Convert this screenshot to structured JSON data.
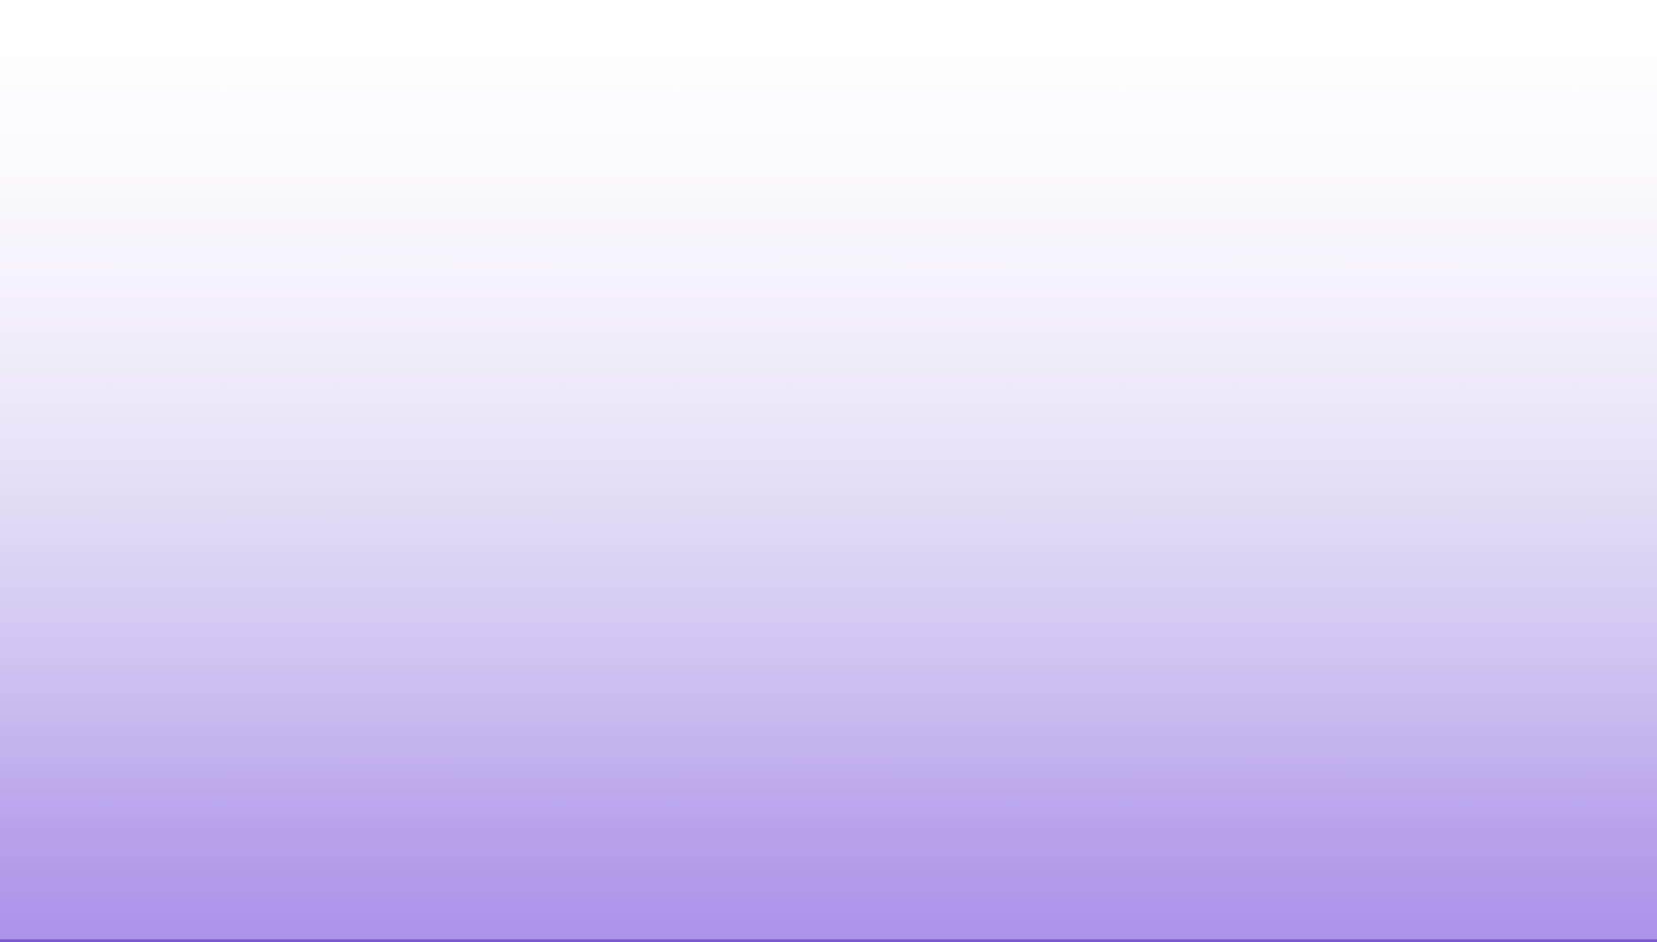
{
  "colors": {
    "gradient_top": "#ffffff",
    "gradient_bottom": "#ab93e8",
    "bottom_edge": "#7b55d6"
  }
}
